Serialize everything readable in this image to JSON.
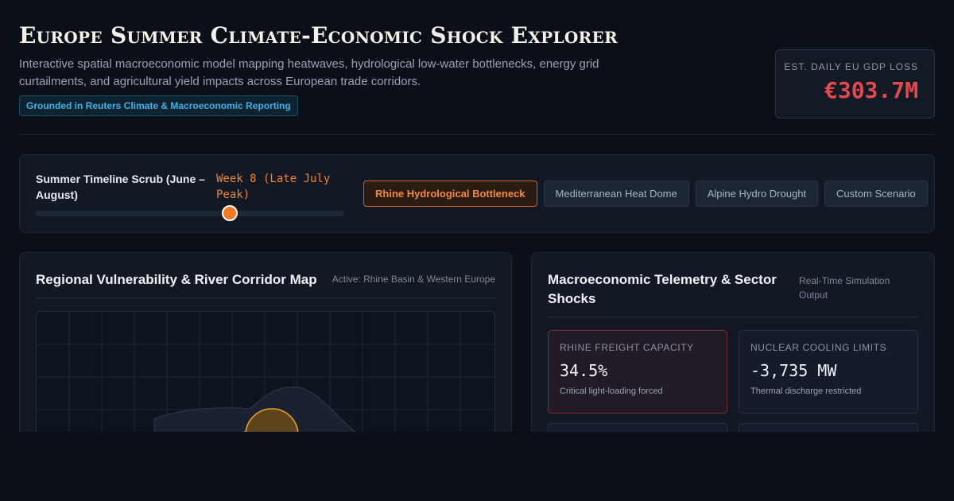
{
  "header": {
    "title": "Europe Summer Climate-Economic Shock Explorer",
    "subtitle": "Interactive spatial macroeconomic model mapping heatwaves, hydrological low-water bottlenecks, energy grid curtailments, and agricultural yield impacts across European trade corridors.",
    "badge": "Grounded in Reuters Climate & Macroeconomic Reporting",
    "gdp_label": "EST. DAILY EU GDP LOSS",
    "gdp_value": "€303.7M"
  },
  "timeline": {
    "label": "Summer Timeline Scrub (June – August)",
    "value_text": "Week 8 (Late July Peak)",
    "position_fraction": 0.63
  },
  "scenarios": [
    {
      "label": "Rhine Hydrological Bottleneck",
      "active": true
    },
    {
      "label": "Mediterranean Heat Dome",
      "active": false
    },
    {
      "label": "Alpine Hydro Drought",
      "active": false
    },
    {
      "label": "Custom Scenario",
      "active": false
    }
  ],
  "map_panel": {
    "title": "Regional Vulnerability & River Corridor Map",
    "active_region": "Active: Rhine Basin & Western Europe"
  },
  "telemetry_panel": {
    "title": "Macroeconomic Telemetry & Sector Shocks",
    "meta": "Real-Time Simulation Output",
    "cards": [
      {
        "label": "RHINE FREIGHT CAPACITY",
        "value": "34.5%",
        "note": "Critical light-loading forced",
        "status": "alert"
      },
      {
        "label": "NUCLEAR COOLING LIMITS",
        "value": "-3,735 MW",
        "note": "Thermal discharge restricted",
        "status": "normal"
      }
    ]
  },
  "colors": {
    "accent_orange": "#f07a21",
    "alert_red": "#e5484d",
    "badge_blue": "#3fb2e8",
    "background": "#0b0f17"
  }
}
